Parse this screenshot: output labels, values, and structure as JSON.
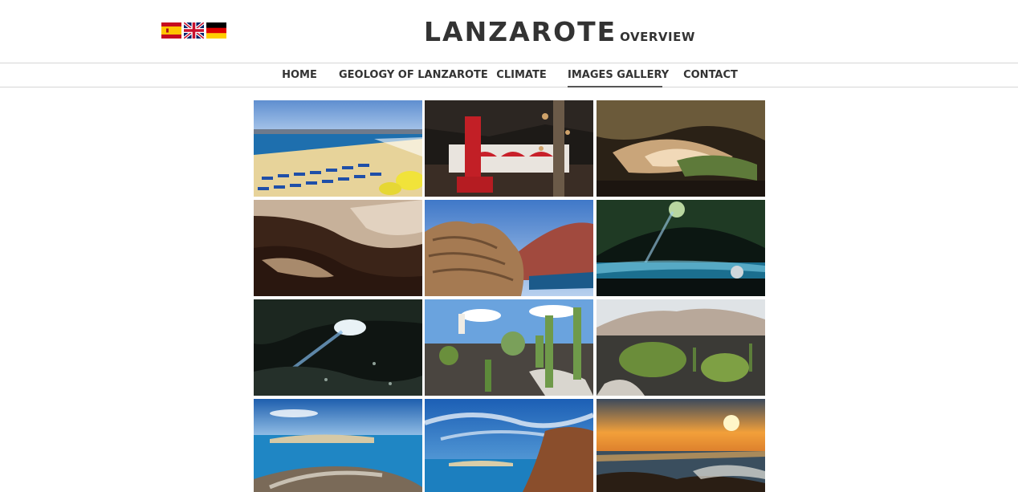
{
  "header": {
    "title": "LANZAROTE",
    "subtitle": "OVERVIEW",
    "languages": [
      {
        "icon": "spanish-flag-icon",
        "name": "Español"
      },
      {
        "icon": "uk-flag-icon",
        "name": "English"
      },
      {
        "icon": "german-flag-icon",
        "name": "Deutsch"
      }
    ]
  },
  "nav": {
    "items": [
      {
        "label": "HOME"
      },
      {
        "label": "GEOLOGY OF LANZAROTE"
      },
      {
        "label": "CLIMATE"
      },
      {
        "label": "IMAGES GALLERY",
        "active": true
      },
      {
        "label": "CONTACT"
      }
    ]
  },
  "gallery": {
    "images": [
      {
        "name": "gallery-image-beach-umbrellas"
      },
      {
        "name": "gallery-image-cave-red-interior"
      },
      {
        "name": "gallery-image-lava-cave-lit"
      },
      {
        "name": "gallery-image-lava-tube-rock"
      },
      {
        "name": "gallery-image-eroded-rock-volcano"
      },
      {
        "name": "gallery-image-jameos-del-agua-lake"
      },
      {
        "name": "gallery-image-cave-light-shaft"
      },
      {
        "name": "gallery-image-cactus-garden-windmill"
      },
      {
        "name": "gallery-image-cactus-garden-mountains"
      },
      {
        "name": "gallery-image-island-view-wall"
      },
      {
        "name": "gallery-image-cliff-ocean-view"
      },
      {
        "name": "gallery-image-sunset-coast"
      }
    ]
  },
  "colors": {
    "text": "#333333",
    "nav_border": "#d6d6d6",
    "active_underline": "#555555"
  }
}
